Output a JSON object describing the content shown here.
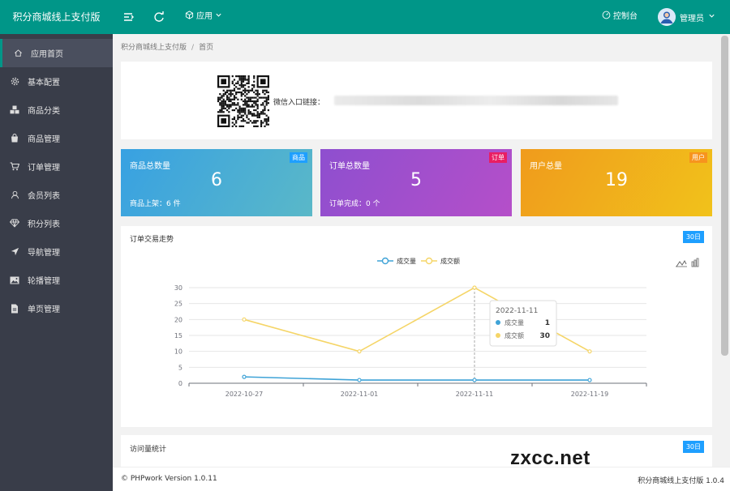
{
  "app": {
    "title": "积分商城线上支付版"
  },
  "topbar": {
    "app_menu_label": "应用",
    "console_label": "控制台",
    "user_label": "管理员"
  },
  "sidebar": {
    "items": [
      {
        "label": "应用首页",
        "icon": "home-icon",
        "active": true
      },
      {
        "label": "基本配置",
        "icon": "gear-icon"
      },
      {
        "label": "商品分类",
        "icon": "cubes-icon"
      },
      {
        "label": "商品管理",
        "icon": "bag-icon"
      },
      {
        "label": "订单管理",
        "icon": "cart-icon"
      },
      {
        "label": "会员列表",
        "icon": "user-icon"
      },
      {
        "label": "积分列表",
        "icon": "diamond-icon"
      },
      {
        "label": "导航管理",
        "icon": "navigation-icon"
      },
      {
        "label": "轮播管理",
        "icon": "image-icon"
      },
      {
        "label": "单页管理",
        "icon": "file-icon"
      }
    ]
  },
  "breadcrumb": {
    "root": "积分商城线上支付版",
    "separator": "/",
    "current": "首页"
  },
  "wechat": {
    "label": "微信入口链接："
  },
  "stats": [
    {
      "title": "商品总数量",
      "value": "6",
      "sub": "商品上架：6 件",
      "badge": "商品",
      "badge_color": "#1e9fff",
      "gradient": [
        "#38a1e2",
        "#5ab8c8"
      ]
    },
    {
      "title": "订单总数量",
      "value": "5",
      "sub": "订单完成：0 个",
      "badge": "订单",
      "badge_color": "#e91e63",
      "gradient": [
        "#8e4fcf",
        "#b54fc9"
      ]
    },
    {
      "title": "用户总量",
      "value": "19",
      "sub": "",
      "badge": "用户",
      "badge_color": "#f7941d",
      "gradient": [
        "#f09b1c",
        "#f1c21b"
      ]
    }
  ],
  "chart_card": {
    "title": "订单交易走势",
    "badge": "30日"
  },
  "visit_card": {
    "title": "访问量统计",
    "badge": "30日"
  },
  "chart_data": {
    "type": "line",
    "x": [
      "2022-10-27",
      "2022-11-01",
      "2022-11-11",
      "2022-11-19"
    ],
    "ylim": [
      0,
      30
    ],
    "yticks": [
      0,
      5,
      10,
      15,
      20,
      25,
      30
    ],
    "series": [
      {
        "name": "成交量",
        "color": "#3fa3d7",
        "values": [
          2,
          1,
          1,
          1
        ]
      },
      {
        "name": "成交额",
        "color": "#f5d567",
        "values": [
          20,
          10,
          30,
          10
        ]
      }
    ],
    "legend_position": "top-center",
    "grid": true,
    "tooltip": {
      "title": "2022-11-11",
      "rows": [
        {
          "name": "成交量",
          "value": "1"
        },
        {
          "name": "成交额",
          "value": "30"
        }
      ]
    }
  },
  "footer": {
    "left": "© PHPwork Version 1.0.11",
    "right": "积分商城线上支付版 1.0.4"
  },
  "watermark": "zxcc.net"
}
